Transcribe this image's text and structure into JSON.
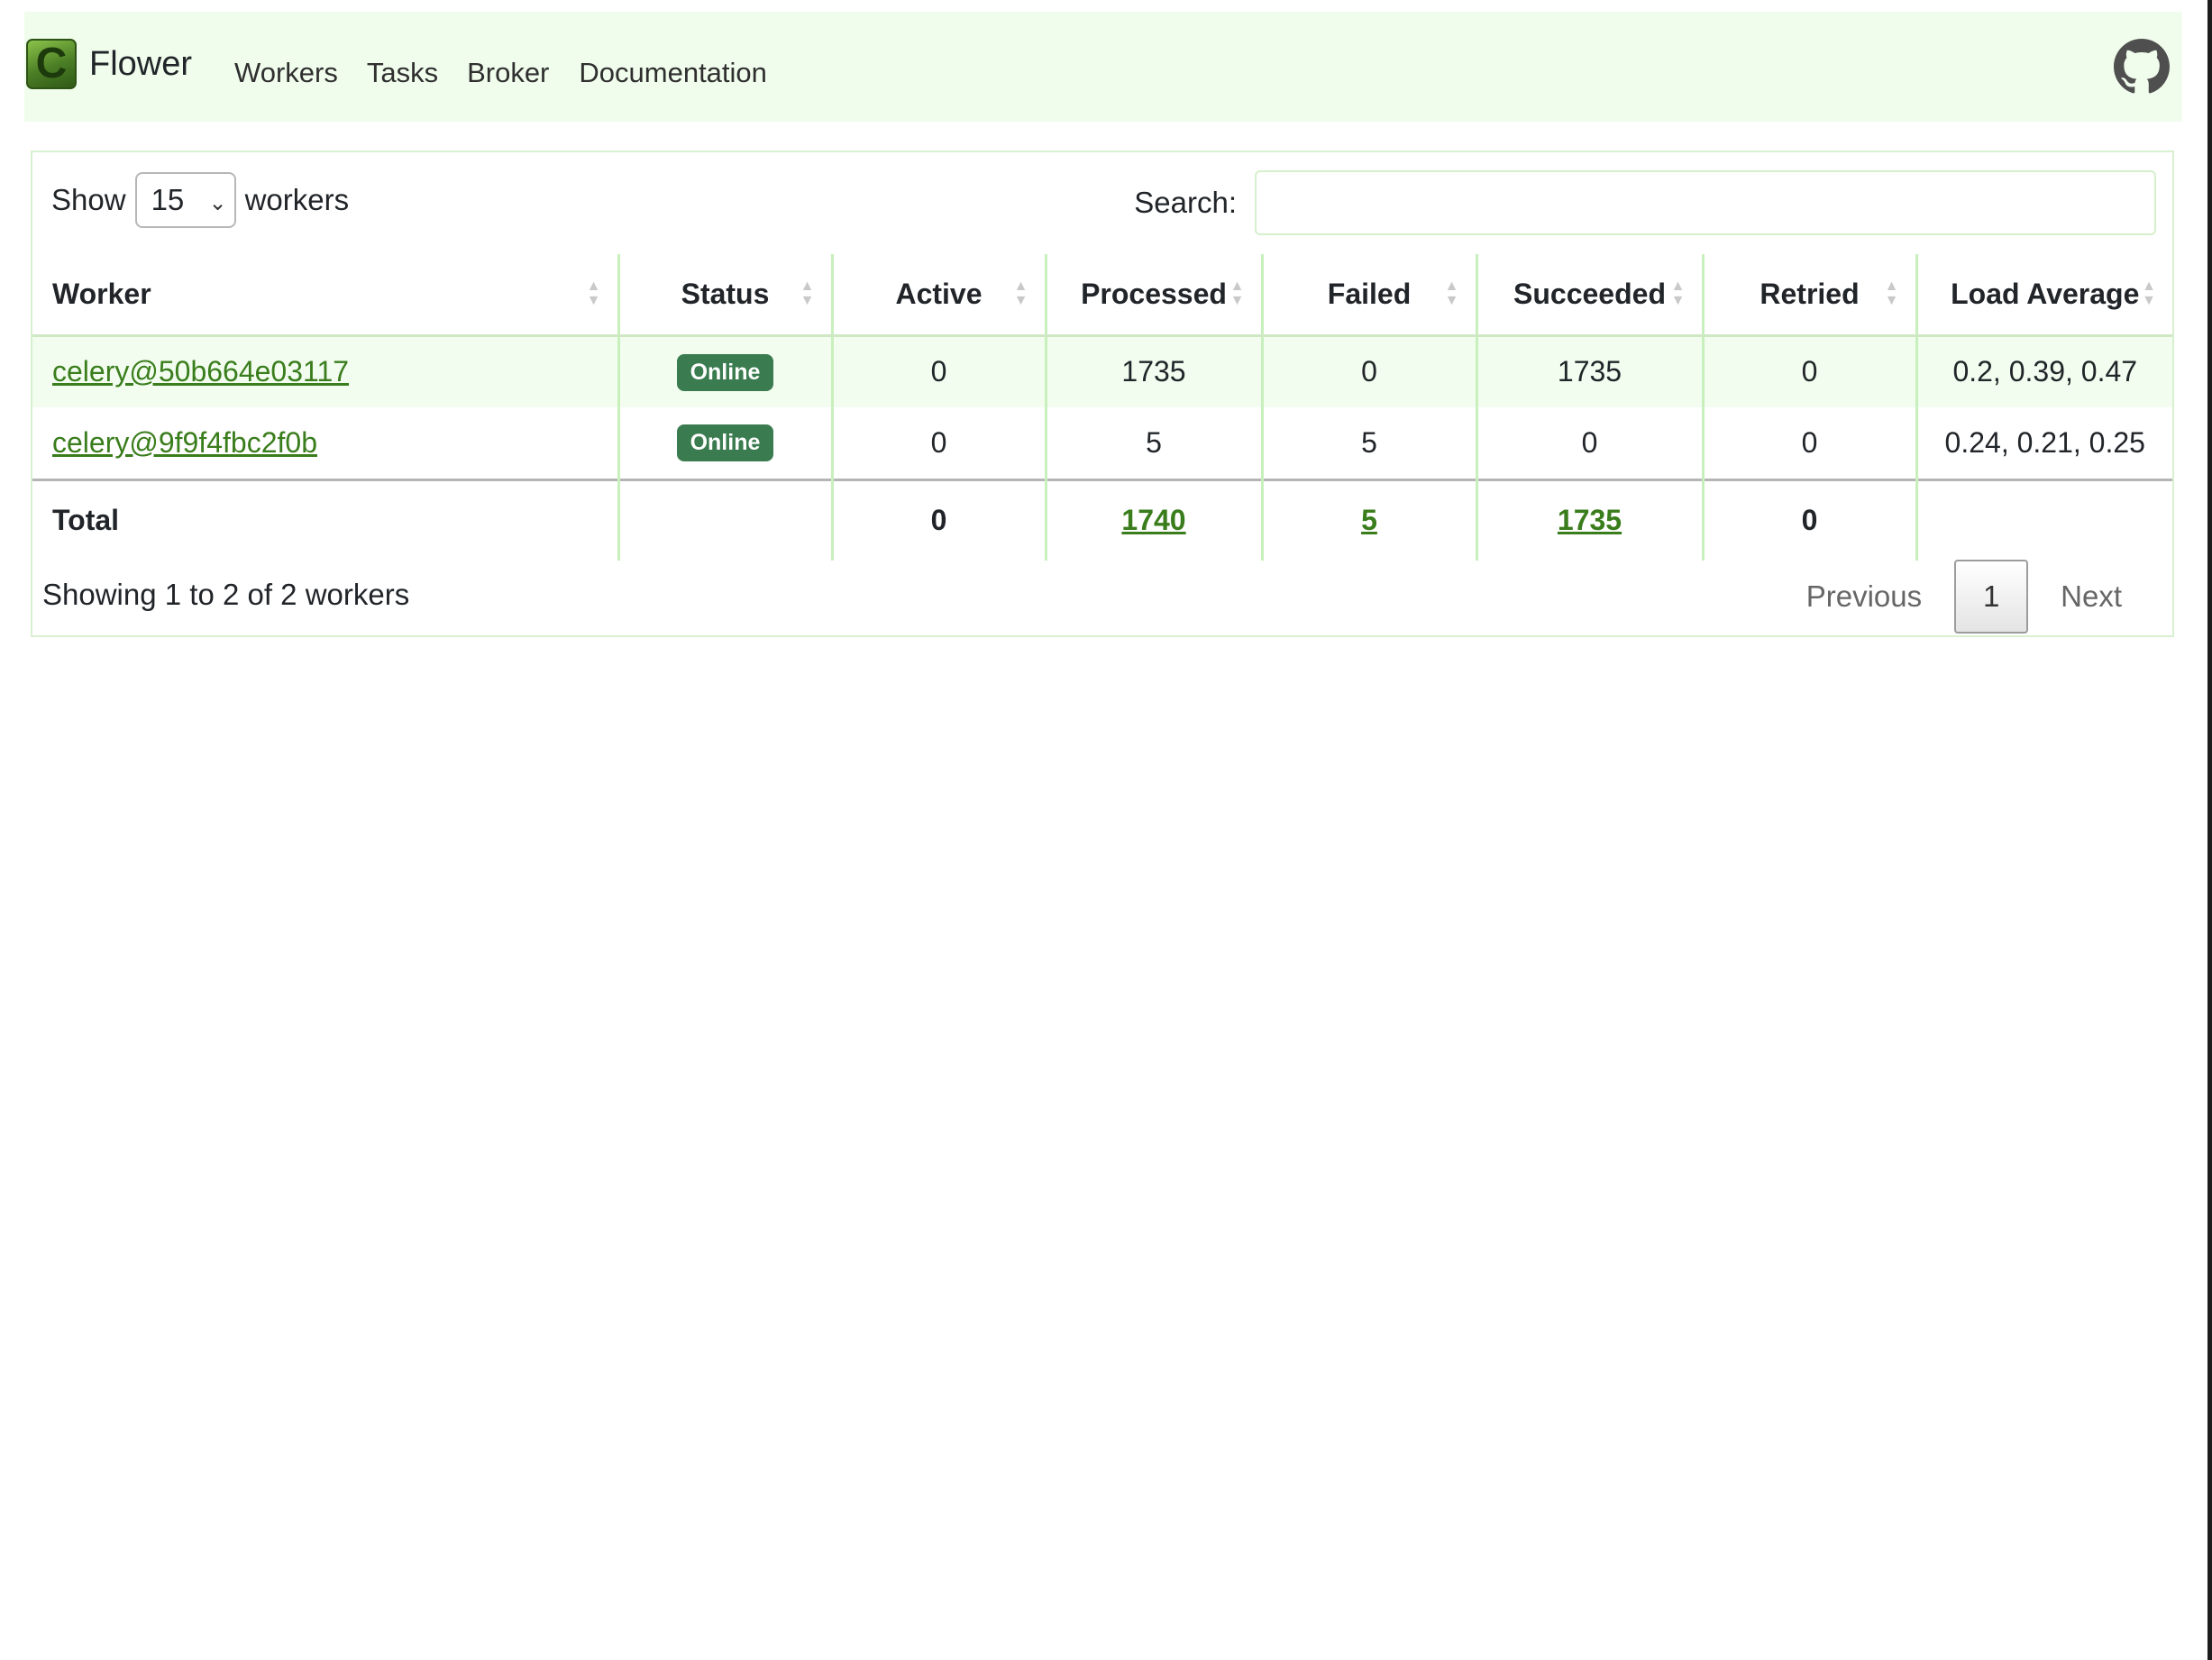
{
  "brand": {
    "name": "Flower",
    "logo_letter": "C"
  },
  "nav": {
    "links": [
      "Workers",
      "Tasks",
      "Broker",
      "Documentation"
    ]
  },
  "controls": {
    "show_label": "Show",
    "page_length": "15",
    "workers_label": "workers",
    "search_label": "Search:",
    "search_value": ""
  },
  "table": {
    "columns": [
      "Worker",
      "Status",
      "Active",
      "Processed",
      "Failed",
      "Succeeded",
      "Retried",
      "Load Average"
    ],
    "rows": [
      {
        "worker": "celery@50b664e03117",
        "status": "Online",
        "active": "0",
        "processed": "1735",
        "failed": "0",
        "succeeded": "1735",
        "retried": "0",
        "load_average": "0.2, 0.39, 0.47"
      },
      {
        "worker": "celery@9f9f4fbc2f0b",
        "status": "Online",
        "active": "0",
        "processed": "5",
        "failed": "5",
        "succeeded": "0",
        "retried": "0",
        "load_average": "0.24, 0.21, 0.25"
      }
    ],
    "totals": {
      "label": "Total",
      "active": "0",
      "processed": "1740",
      "failed": "5",
      "succeeded": "1735",
      "retried": "0"
    }
  },
  "footer": {
    "info": "Showing 1 to 2 of 2 workers",
    "previous": "Previous",
    "current_page": "1",
    "next": "Next"
  },
  "colors": {
    "navbar_bg": "#f0fdec",
    "link": "#3a7d1c",
    "badge": "#3a7b4f"
  },
  "icons": {
    "github": "github-icon",
    "sort": "sort-icon",
    "dropdown": "chevron-down-icon"
  }
}
